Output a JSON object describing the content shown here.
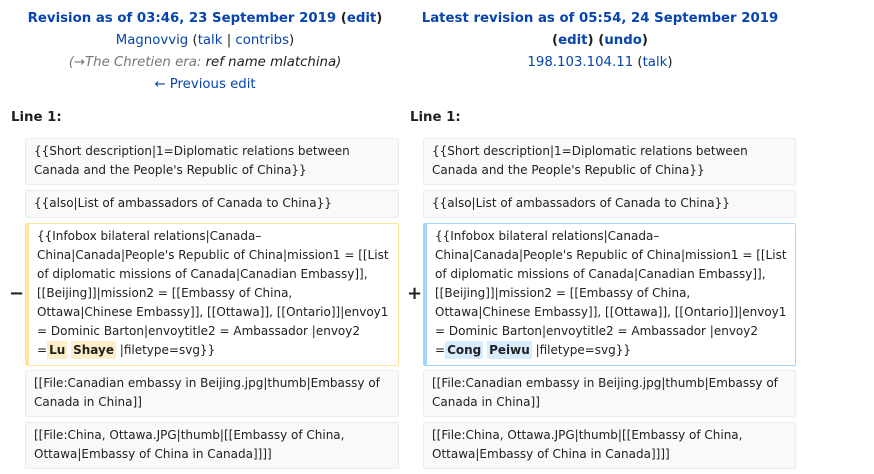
{
  "left": {
    "title_prefix": "Revision as of 03:46, 23 September 2019",
    "title_open": "(",
    "edit_label": "edit",
    "title_close": ")",
    "user": "Magnovvig",
    "talk_open": "(",
    "talk_label": "talk",
    "sep": "|",
    "contribs_label": "contribs",
    "talk_close": ")",
    "summary_arrow": "(→The Chretien era:",
    "summary_text": "ref name mlatchina)",
    "prev_label": "← Previous edit",
    "line_label": "Line 1:"
  },
  "right": {
    "title": "Latest revision as of 05:54, 24 September 2019",
    "edit_label": "edit",
    "undo_label": "undo",
    "ip": "198.103.104.11",
    "talk_label": "talk",
    "line_label": "Line 1:"
  },
  "diff": {
    "minus": "−",
    "plus": "+",
    "row1": "{{Short description|1=Diplomatic relations between Canada and the People's Republic of China}}",
    "row2": "{{also|List of ambassadors of Canada to China}}",
    "row3_before": "{{Infobox bilateral relations|Canada– China|Canada|People's Republic of China|mission1 = [[List of diplomatic missions of Canada|Canadian Embassy]], [[Beijing]]|mission2 = [[Embassy of China, Ottawa|Chinese Embassy]], [[Ottawa]], [[Ontario]]|envoy1 = Dominic Barton|envoytitle2 = Ambassador |envoy2 =",
    "row3_old_a": "Lu",
    "row3_old_b": "Shaye",
    "row3_new_a": "Cong",
    "row3_new_b": "Peiwu",
    "row3_after": " |filetype=svg}}",
    "row4": "[[File:Canadian embassy in Beijing.jpg|thumb|Embassy of Canada in China]]",
    "row5": "[[File:China, Ottawa.JPG|thumb|[[Embassy of China, Ottawa|Embassy of China in Canada]]]]"
  }
}
